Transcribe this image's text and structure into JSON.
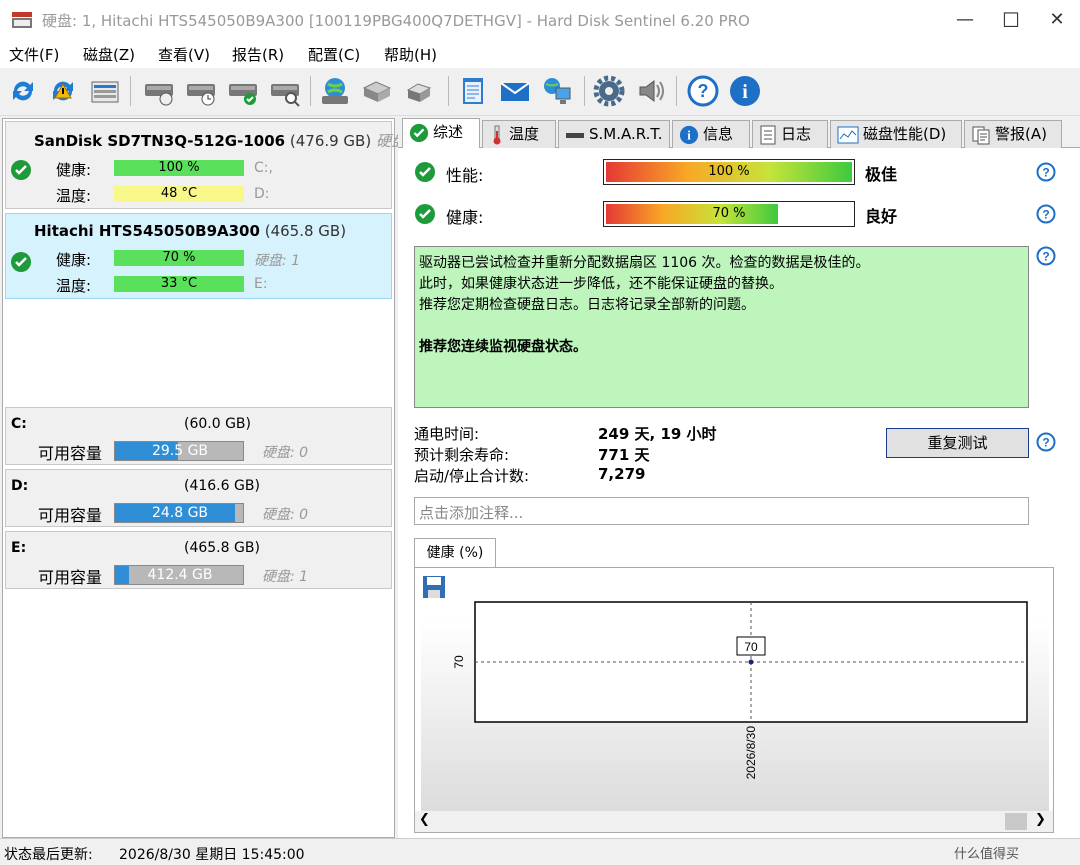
{
  "window": {
    "title": "硬盘:  1, Hitachi HTS545050B9A300 [100119PBG400Q7DETHGV]  -  Hard Disk Sentinel 6.20 PRO",
    "minimize": "—",
    "maximize": "☐",
    "close": "✕"
  },
  "menu": [
    "文件(F)",
    "磁盘(Z)",
    "查看(V)",
    "报告(R)",
    "配置(C)",
    "帮助(H)"
  ],
  "toolbar_icons": [
    "refresh-icon",
    "refresh-warning-icon",
    "disk-list-icon",
    "disk-test-icon",
    "disk-schedule-icon",
    "disk-check-icon",
    "disk-search-icon",
    "globe-disk-icon",
    "network-disk-icon",
    "drive-icon",
    "notepad-icon",
    "email-icon",
    "computer-network-icon",
    "settings-gear-icon",
    "sound-icon",
    "help-icon",
    "info-icon"
  ],
  "disks": [
    {
      "model": "SanDisk SD7TN3Q-512G-1006",
      "size": "(476.9 GB)",
      "disk_label": "硬盘:",
      "health_label": "健康:",
      "health": "100 %",
      "health_value": 100,
      "health_color": "#5ae05a",
      "health_extra": "C:,",
      "temp_label": "温度:",
      "temp": "48 °C",
      "temp_color": "#f7f78a",
      "temp_extra": "D:"
    },
    {
      "model": "Hitachi HTS545050B9A300",
      "size": "(465.8 GB)",
      "health_label": "健康:",
      "health": "70 %",
      "health_value": 70,
      "health_color": "#5ae05a",
      "health_extra": "硬盘:  1",
      "temp_label": "温度:",
      "temp": "33 °C",
      "temp_color": "#5ae05a",
      "temp_extra": "E:"
    }
  ],
  "partitions": [
    {
      "letter": "C:",
      "size": "(60.0 GB)",
      "free_label": "可用容量",
      "free": "29.5 GB",
      "fill": 0.49,
      "disk": "硬盘:  0"
    },
    {
      "letter": "D:",
      "size": "(416.6 GB)",
      "free_label": "可用容量",
      "free": "24.8 GB",
      "fill": 0.94,
      "disk": "硬盘:  0"
    },
    {
      "letter": "E:",
      "size": "(465.8 GB)",
      "free_label": "可用容量",
      "free": "412.4 GB",
      "fill": 0.11,
      "disk": "硬盘:  1"
    }
  ],
  "tabs": [
    {
      "label": "综述",
      "icon": "check-icon"
    },
    {
      "label": "温度",
      "icon": "thermometer-icon"
    },
    {
      "label": "S.M.A.R.T.",
      "icon": "smart-icon"
    },
    {
      "label": "信息",
      "icon": "info-icon"
    },
    {
      "label": "日志",
      "icon": "log-icon"
    },
    {
      "label": "磁盘性能(D)",
      "icon": "performance-icon"
    },
    {
      "label": "警报(A)",
      "icon": "alert-icon"
    }
  ],
  "overview": {
    "performance_label": "性能:",
    "performance_value": "100 %",
    "performance_pct": 100,
    "performance_rating": "极佳",
    "health_label": "健康:",
    "health_value": "70 %",
    "health_pct": 70,
    "health_rating": "良好",
    "message_lines": [
      "驱动器已尝试检查并重新分配数据扇区  1106  次。检查的数据是极佳的。",
      "此时，如果健康状态进一步降低，还不能保证硬盘的替换。",
      "推荐您定期检查硬盘日志。日志将记录全部新的问题。"
    ],
    "message_bold": "推荐您连续监视硬盘状态。",
    "power_on_label": "通电时间:",
    "power_on_value": "249 天, 19 小时",
    "life_label": "预计剩余寿命:",
    "life_value": "771 天",
    "startstop_label": "启动/停止合计数:",
    "startstop_value": "7,279",
    "retest_button": "重复测试",
    "note_placeholder": "点击添加注释..."
  },
  "chart_tab": "健康 (%)",
  "chart_data": {
    "type": "line",
    "x": [
      "2026/8/30"
    ],
    "values": [
      70
    ],
    "data_labels": [
      "70"
    ],
    "ytick": "70",
    "xtick": "2026/8/30",
    "xlabel": "",
    "ylabel": ""
  },
  "statusbar": {
    "label": "状态最后更新:",
    "value": "2026/8/30 星期日 15:45:00"
  },
  "watermark": "什么值得买"
}
